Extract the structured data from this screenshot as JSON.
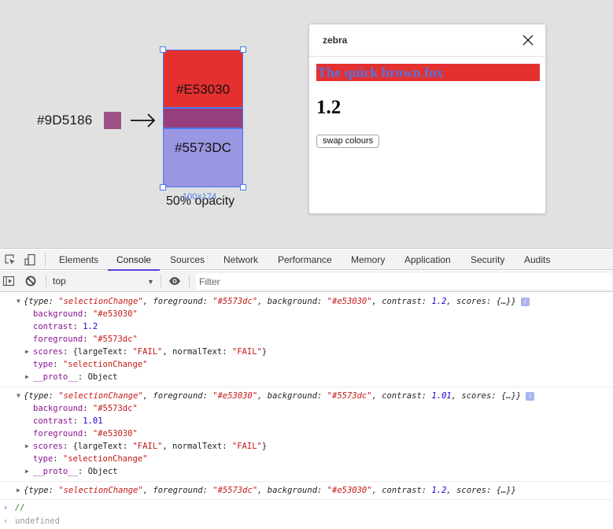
{
  "canvas": {
    "mixed_color_label": "#9D5186",
    "mixed_color": "#9D5186",
    "arrow": "→",
    "blocks": [
      {
        "label": "#E53030",
        "color": "#E53030"
      },
      {
        "label": "#5573DC",
        "color": "#5573DC",
        "opacity": 0.5,
        "rendered_color": "#9B96E2"
      }
    ],
    "overlap_color": "#973E7C",
    "selection_size_label": "100×174",
    "opacity_label": "50% opacity",
    "selection_color": "#4B7BF0"
  },
  "panel": {
    "title": "zebra",
    "close_icon": "close-icon",
    "sample_text": "The quick brown fox",
    "sample_foreground": "#5573DC",
    "sample_background": "#E53030",
    "contrast_ratio": "1.2",
    "swap_button_label": "swap colours"
  },
  "devtools": {
    "tabs": [
      {
        "label": "Elements",
        "active": false
      },
      {
        "label": "Console",
        "active": true
      },
      {
        "label": "Sources",
        "active": false
      },
      {
        "label": "Network",
        "active": false
      },
      {
        "label": "Performance",
        "active": false
      },
      {
        "label": "Memory",
        "active": false
      },
      {
        "label": "Application",
        "active": false
      },
      {
        "label": "Security",
        "active": false
      },
      {
        "label": "Audits",
        "active": false
      }
    ],
    "context_select": "top",
    "filter_placeholder": "Filter",
    "accent_color": "#5A3FD6"
  },
  "console": {
    "messages": [
      {
        "expanded": true,
        "summary": {
          "type": "\"selectionChange\"",
          "foreground": "\"#5573dc\"",
          "background": "\"#e53030\"",
          "contrast": "1.2",
          "scores": "{…}"
        },
        "props": {
          "background": "\"#e53030\"",
          "contrast": "1.2",
          "foreground": "\"#5573dc\"",
          "scores_large": "\"FAIL\"",
          "scores_normal": "\"FAIL\"",
          "type": "\"selectionChange\"",
          "proto": "Object"
        }
      },
      {
        "expanded": true,
        "summary": {
          "type": "\"selectionChange\"",
          "foreground": "\"#e53030\"",
          "background": "\"#5573dc\"",
          "contrast": "1.01",
          "scores": "{…}"
        },
        "props": {
          "background": "\"#5573dc\"",
          "contrast": "1.01",
          "foreground": "\"#e53030\"",
          "scores_large": "\"FAIL\"",
          "scores_normal": "\"FAIL\"",
          "type": "\"selectionChange\"",
          "proto": "Object"
        }
      },
      {
        "expanded": false,
        "summary": {
          "type": "\"selectionChange\"",
          "foreground": "\"#5573dc\"",
          "background": "\"#e53030\"",
          "contrast": "1.2",
          "scores": "{…}"
        }
      }
    ],
    "input": "//",
    "result": "undefined",
    "info_badge": "i"
  }
}
